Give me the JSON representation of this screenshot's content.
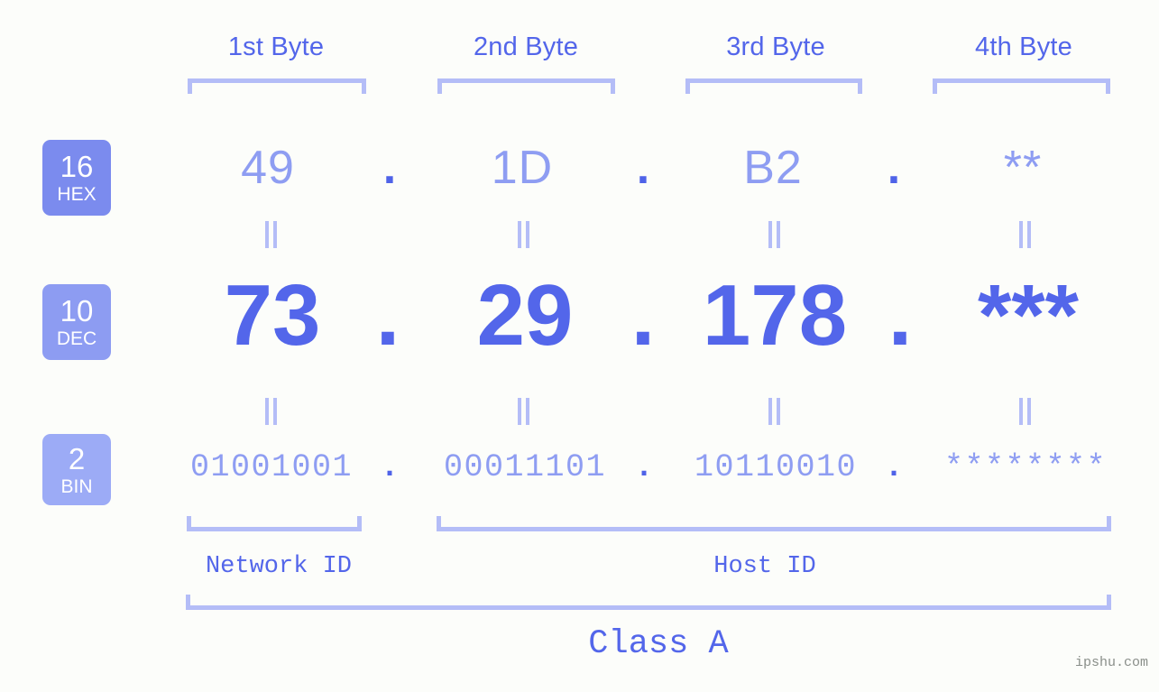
{
  "page": {
    "background_color": "#fcfdfa",
    "accent_color": "#5366ea",
    "accent_light_color": "#8e9df2",
    "bracket_color": "#b4bdf7",
    "watermark": "ipshu.com"
  },
  "byte_headers": [
    {
      "label": "1st Byte"
    },
    {
      "label": "2nd Byte"
    },
    {
      "label": "3rd Byte"
    },
    {
      "label": "4th Byte"
    }
  ],
  "bases": [
    {
      "number": "16",
      "name": "HEX",
      "color": "#7b8bee"
    },
    {
      "number": "10",
      "name": "DEC",
      "color": "#8d9cf2"
    },
    {
      "number": "2",
      "name": "BIN",
      "color": "#9cabf6"
    }
  ],
  "separator": ".",
  "rows": {
    "hex": {
      "values": [
        "49",
        "1D",
        "B2",
        "**"
      ]
    },
    "dec": {
      "values": [
        "73",
        "29",
        "178",
        "***"
      ]
    },
    "bin": {
      "values": [
        "01001001",
        "00011101",
        "10110010",
        "********"
      ]
    }
  },
  "equals_glyph": "=",
  "sections": [
    {
      "label": "Network ID"
    },
    {
      "label": "Host ID"
    }
  ],
  "class": {
    "label": "Class A"
  }
}
